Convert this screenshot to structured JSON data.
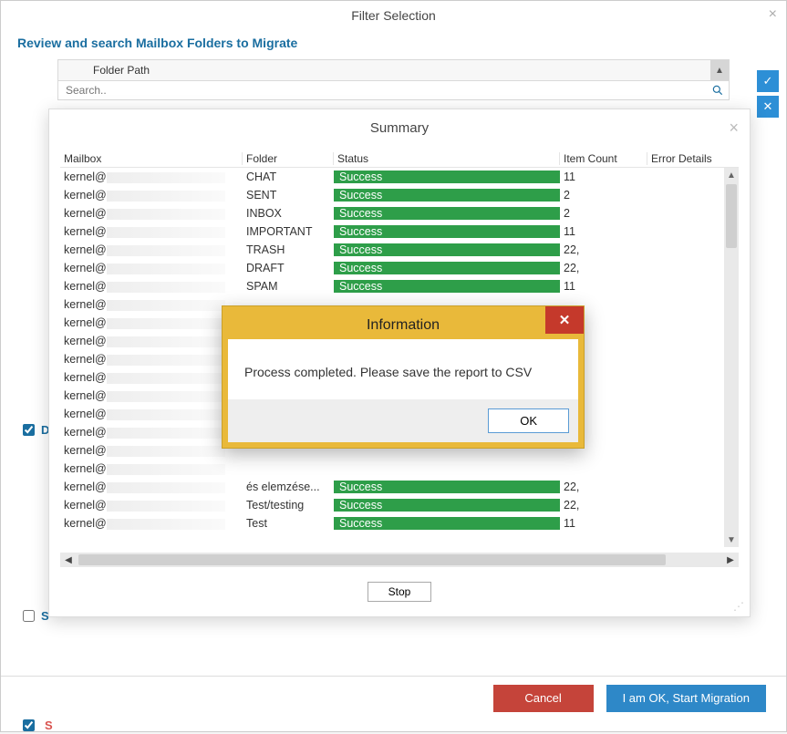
{
  "filter_dialog": {
    "title": "Filter Selection",
    "review_title": "Review and search Mailbox Folders to Migrate",
    "folder_path_header": "Folder Path",
    "search_placeholder": "Search.."
  },
  "left_checks": {
    "d_label": "D",
    "s_label": "S",
    "red_label": "S"
  },
  "summary": {
    "title": "Summary",
    "columns": {
      "mailbox": "Mailbox",
      "folder": "Folder",
      "status": "Status",
      "item_count": "Item Count",
      "error": "Error Details"
    },
    "rows": [
      {
        "mailbox": "kernel@",
        "folder": "CHAT",
        "status": "Success",
        "count": "11"
      },
      {
        "mailbox": "kernel@",
        "folder": "SENT",
        "status": "Success",
        "count": "2"
      },
      {
        "mailbox": "kernel@",
        "folder": "INBOX",
        "status": "Success",
        "count": "2"
      },
      {
        "mailbox": "kernel@",
        "folder": "IMPORTANT",
        "status": "Success",
        "count": "11"
      },
      {
        "mailbox": "kernel@",
        "folder": "TRASH",
        "status": "Success",
        "count": "22,"
      },
      {
        "mailbox": "kernel@",
        "folder": "DRAFT",
        "status": "Success",
        "count": "22,"
      },
      {
        "mailbox": "kernel@",
        "folder": "SPAM",
        "status": "Success",
        "count": "11"
      },
      {
        "mailbox": "kernel@",
        "folder": "",
        "status": "",
        "count": ""
      },
      {
        "mailbox": "kernel@",
        "folder": "",
        "status": "",
        "count": ""
      },
      {
        "mailbox": "kernel@",
        "folder": "",
        "status": "",
        "count": ""
      },
      {
        "mailbox": "kernel@",
        "folder": "",
        "status": "",
        "count": ""
      },
      {
        "mailbox": "kernel@",
        "folder": "",
        "status": "",
        "count": ""
      },
      {
        "mailbox": "kernel@",
        "folder": "",
        "status": "",
        "count": ""
      },
      {
        "mailbox": "kernel@",
        "folder": "",
        "status": "",
        "count": ""
      },
      {
        "mailbox": "kernel@",
        "folder": "",
        "status": "",
        "count": ""
      },
      {
        "mailbox": "kernel@",
        "folder": "",
        "status": "",
        "count": ""
      },
      {
        "mailbox": "kernel@",
        "folder": "",
        "status": "",
        "count": ""
      },
      {
        "mailbox": "kernel@",
        "folder": "és elemzése...",
        "status": "Success",
        "count": "22,"
      },
      {
        "mailbox": "kernel@",
        "folder": "Test/testing",
        "status": "Success",
        "count": "22,"
      },
      {
        "mailbox": "kernel@",
        "folder": "Test",
        "status": "Success",
        "count": "11"
      }
    ],
    "stop_label": "Stop"
  },
  "info": {
    "title": "Information",
    "message": "Process completed. Please save the report to CSV",
    "ok_label": "OK"
  },
  "buttons": {
    "cancel": "Cancel",
    "start": "I am OK, Start Migration"
  }
}
